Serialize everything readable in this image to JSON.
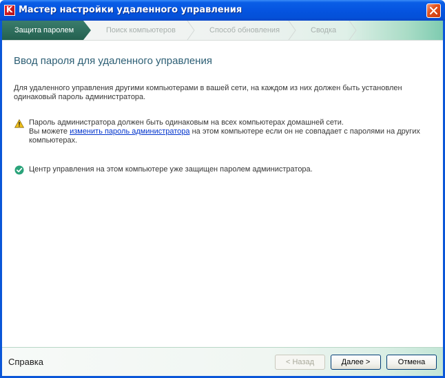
{
  "window": {
    "title": "Мастер настройки удаленного управления"
  },
  "steps": [
    {
      "label": "Защита паролем",
      "active": true
    },
    {
      "label": "Поиск компьютеров",
      "active": false
    },
    {
      "label": "Способ обновления",
      "active": false
    },
    {
      "label": "Сводка",
      "active": false
    }
  ],
  "content": {
    "heading": "Ввод пароля для удаленного управления",
    "intro": "Для удаленного управления другими компьютерами в вашей сети, на каждом из них должен быть установлен одинаковый пароль администратора.",
    "warning": {
      "line1": "Пароль администратора должен быть одинаковым на всех компьютерах домашней сети.",
      "line2_prefix": "Вы можете ",
      "link": "изменить пароль администратора",
      "line2_suffix": " на этом компьютере если он не совпадает с паролями на других компьютерах."
    },
    "status": "Центр управления на этом компьютере уже защищен паролем администратора."
  },
  "footer": {
    "help_label": "Справка",
    "back_label": "< Назад",
    "next_label": "Далее >",
    "cancel_label": "Отмена"
  },
  "colors": {
    "accent": "#2c5e74",
    "active_step": "#2e6f5d",
    "link": "#0033cc",
    "warning_icon": "#f2c21b",
    "ok_icon": "#2aa37a"
  },
  "icons": {
    "app": "kaspersky-logo",
    "close": "close-icon",
    "warning": "warning-icon",
    "ok": "checkmark-icon"
  }
}
